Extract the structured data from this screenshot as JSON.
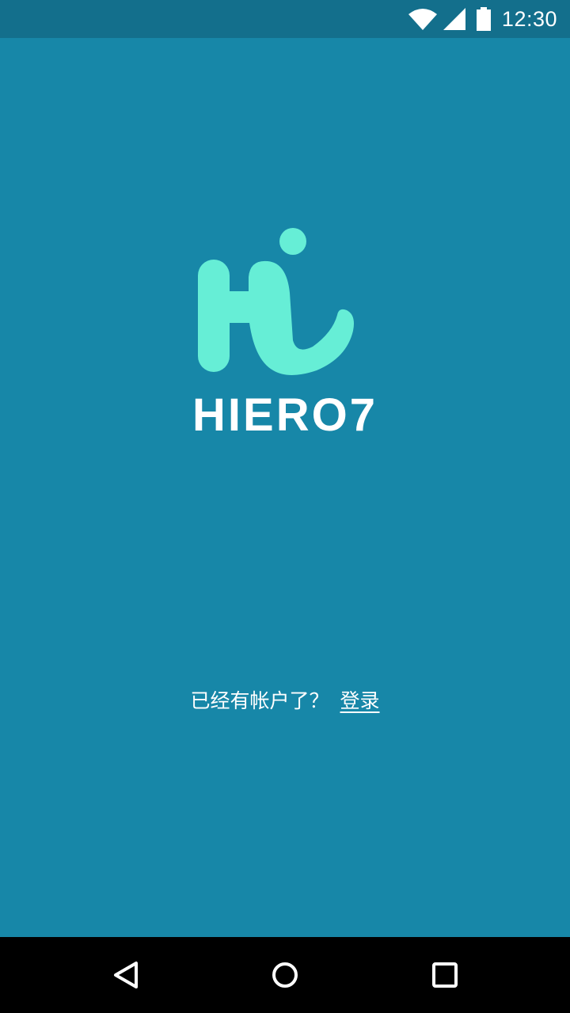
{
  "status_bar": {
    "time": "12:30",
    "icons": [
      "wifi-icon",
      "signal-icon",
      "battery-icon"
    ],
    "background": "#136f8c"
  },
  "brand": {
    "logo_icon": "hi-logo-icon",
    "logo_color": "#66eed6",
    "name": "HIERO7"
  },
  "login": {
    "prompt": "已经有帐户了？",
    "link_label": "登录"
  },
  "nav_bar": {
    "icons": [
      "back-icon",
      "home-icon",
      "recent-apps-icon"
    ]
  },
  "colors": {
    "background": "#1787a8",
    "text": "#ffffff"
  }
}
